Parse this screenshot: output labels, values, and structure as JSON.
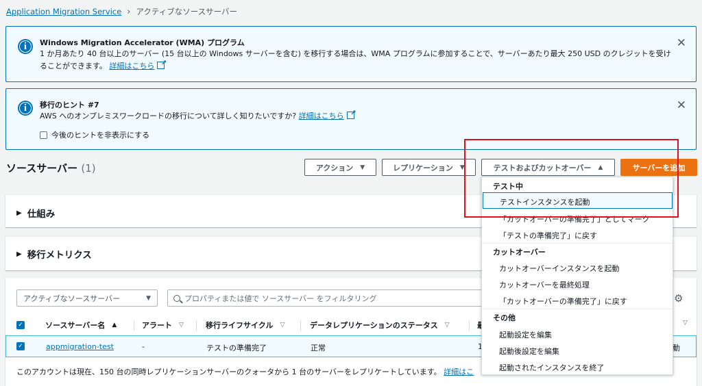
{
  "breadcrumb": {
    "root": "Application Migration Service",
    "current": "アクティブなソースサーバー"
  },
  "alert1": {
    "title": "Windows Migration Accelerator (WMA) プログラム",
    "line1": "1 か月あたり 40 台以上のサーバー (15 台以上の Windows サーバーを含む) を移行する場合は、WMA プログラムに参加することで、サーバーあたり最大 250 USD のクレジットを受け",
    "line2": "ることができます。",
    "link": "詳細はこちら"
  },
  "alert2": {
    "title": "移行のヒント #7",
    "line1": "AWS へのオンプレミスワークロードの移行について詳しく知りたいですか?",
    "link": "詳細はこちら",
    "checkbox_label": "今後のヒントを非表示にする"
  },
  "source_servers": {
    "title": "ソースサーバー",
    "count": "(1)"
  },
  "toolbar": {
    "actions": "アクション",
    "replication": "レプリケーション",
    "test_cutover": "テストおよびカットオーバー",
    "add_server": "サーバーを追加"
  },
  "panels": {
    "how_it_works": "仕組み",
    "migration_metrics": "移行メトリクス"
  },
  "filter": {
    "select_value": "アクティブなソースサーバー",
    "search_placeholder": "プロパティまたは値で ソースサーバー をフィルタリング"
  },
  "table": {
    "headers": [
      "ソースサーバー名",
      "アラート",
      "移行ライフサイクル",
      "データレプリケーションのステータス"
    ],
    "rows": [
      {
        "name": "appmigration-test",
        "alert": "-",
        "lifecycle": "テストの準備完了",
        "replication": "正常"
      }
    ]
  },
  "footer_note": {
    "text": "このアカウントは現在、150 台の同時レプリケーションサーバーのクォータから 1 台のサーバーをレプリケートしています。",
    "link": "詳細はこ"
  },
  "dropdown": {
    "group_testing": "テスト中",
    "launch_test": "テストインスタンスを起動",
    "mark_ready_cutover": "「カットオーバーの準備完了」としてマーク",
    "revert_ready_test": "「テストの準備完了」に戻す",
    "group_cutover": "カットオーバー",
    "launch_cutover": "カットオーバーインスタンスを起動",
    "finalize_cutover": "カットオーバーを最終処理",
    "revert_ready_cutover": "「カットオーバーの準備完了」に戻す",
    "group_other": "その他",
    "edit_launch": "起動設定を編集",
    "edit_post_launch": "起動後設定を編集",
    "terminate_launched": "起動されたインスタンスを終了"
  },
  "partially_hidden": {
    "header_fragment": "最",
    "row_fragment": "1",
    "right_fragment": "動"
  },
  "colors": {
    "primary": "#ec7211",
    "link": "#0073bb",
    "highlight": "#e0101b"
  }
}
